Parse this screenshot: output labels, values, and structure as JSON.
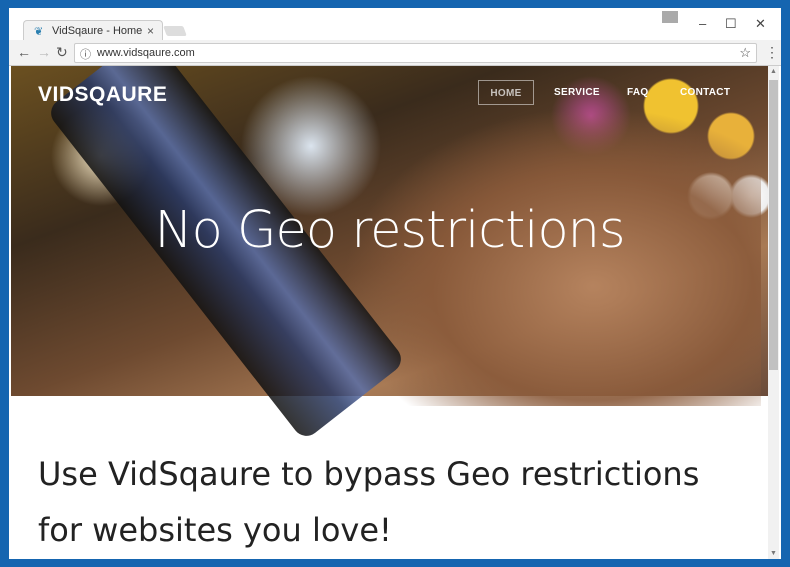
{
  "browser": {
    "tab_title": "VidSqaure - Home",
    "url": "www.vidsqaure.com"
  },
  "site": {
    "logo": "VIDSQAURE",
    "nav": [
      "HOME",
      "SERVICE",
      "FAQ",
      "CONTACT"
    ],
    "hero_headline": "No Geo restrictions",
    "tagline": "Use VidSqaure to bypass Geo restrictions for websites you love!"
  },
  "icons": {
    "favicon": "bird-icon",
    "back": "←",
    "forward": "→",
    "reload": "↻",
    "info": "ⓘ",
    "star": "☆",
    "menu": "⋮",
    "minimize": "–",
    "maximize": "☐",
    "close": "✕",
    "tab_close": "×"
  }
}
